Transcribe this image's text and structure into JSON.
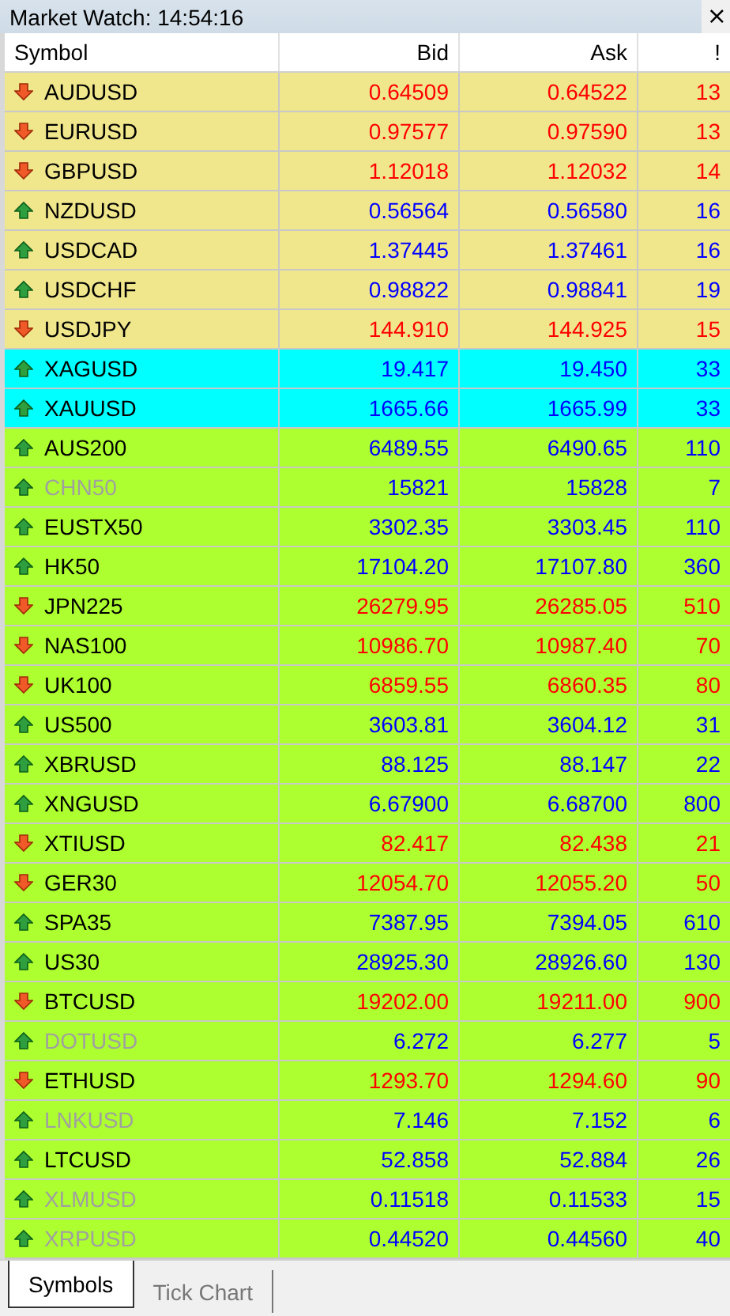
{
  "window": {
    "title": "Market Watch: 14:54:16",
    "close": "×"
  },
  "table": {
    "columns": [
      "Symbol",
      "Bid",
      "Ask",
      "!"
    ],
    "rows": [
      {
        "symbol": "AUDUSD",
        "rising": false,
        "disabled": false,
        "bid": "0.64509",
        "ask": "0.64522",
        "spread": "13",
        "color": "#f0e68c"
      },
      {
        "symbol": "EURUSD",
        "rising": false,
        "disabled": false,
        "bid": "0.97577",
        "ask": "0.97590",
        "spread": "13",
        "color": "#f0e68c"
      },
      {
        "symbol": "GBPUSD",
        "rising": false,
        "disabled": false,
        "bid": "1.12018",
        "ask": "1.12032",
        "spread": "14",
        "color": "#f0e68c"
      },
      {
        "symbol": "NZDUSD",
        "rising": true,
        "disabled": false,
        "bid": "0.56564",
        "ask": "0.56580",
        "spread": "16",
        "color": "#f0e68c"
      },
      {
        "symbol": "USDCAD",
        "rising": true,
        "disabled": false,
        "bid": "1.37445",
        "ask": "1.37461",
        "spread": "16",
        "color": "#f0e68c"
      },
      {
        "symbol": "USDCHF",
        "rising": true,
        "disabled": false,
        "bid": "0.98822",
        "ask": "0.98841",
        "spread": "19",
        "color": "#f0e68c"
      },
      {
        "symbol": "USDJPY",
        "rising": false,
        "disabled": false,
        "bid": "144.910",
        "ask": "144.925",
        "spread": "15",
        "color": "#f0e68c"
      },
      {
        "symbol": "XAGUSD",
        "rising": true,
        "disabled": false,
        "bid": "19.417",
        "ask": "19.450",
        "spread": "33",
        "color": "#00ffff"
      },
      {
        "symbol": "XAUUSD",
        "rising": true,
        "disabled": false,
        "bid": "1665.66",
        "ask": "1665.99",
        "spread": "33",
        "color": "#00ffff"
      },
      {
        "symbol": "AUS200",
        "rising": true,
        "disabled": false,
        "bid": "6489.55",
        "ask": "6490.65",
        "spread": "110",
        "color": "#adff2f"
      },
      {
        "symbol": "CHN50",
        "rising": true,
        "disabled": true,
        "bid": "15821",
        "ask": "15828",
        "spread": "7",
        "color": "#adff2f"
      },
      {
        "symbol": "EUSTX50",
        "rising": true,
        "disabled": false,
        "bid": "3302.35",
        "ask": "3303.45",
        "spread": "110",
        "color": "#adff2f"
      },
      {
        "symbol": "HK50",
        "rising": true,
        "disabled": false,
        "bid": "17104.20",
        "ask": "17107.80",
        "spread": "360",
        "color": "#adff2f"
      },
      {
        "symbol": "JPN225",
        "rising": false,
        "disabled": false,
        "bid": "26279.95",
        "ask": "26285.05",
        "spread": "510",
        "color": "#adff2f"
      },
      {
        "symbol": "NAS100",
        "rising": false,
        "disabled": false,
        "bid": "10986.70",
        "ask": "10987.40",
        "spread": "70",
        "color": "#adff2f"
      },
      {
        "symbol": "UK100",
        "rising": false,
        "disabled": false,
        "bid": "6859.55",
        "ask": "6860.35",
        "spread": "80",
        "color": "#adff2f"
      },
      {
        "symbol": "US500",
        "rising": true,
        "disabled": false,
        "bid": "3603.81",
        "ask": "3604.12",
        "spread": "31",
        "color": "#adff2f"
      },
      {
        "symbol": "XBRUSD",
        "rising": true,
        "disabled": false,
        "bid": "88.125",
        "ask": "88.147",
        "spread": "22",
        "color": "#adff2f"
      },
      {
        "symbol": "XNGUSD",
        "rising": true,
        "disabled": false,
        "bid": "6.67900",
        "ask": "6.68700",
        "spread": "800",
        "color": "#adff2f"
      },
      {
        "symbol": "XTIUSD",
        "rising": false,
        "disabled": false,
        "bid": "82.417",
        "ask": "82.438",
        "spread": "21",
        "color": "#adff2f"
      },
      {
        "symbol": "GER30",
        "rising": false,
        "disabled": false,
        "bid": "12054.70",
        "ask": "12055.20",
        "spread": "50",
        "color": "#adff2f"
      },
      {
        "symbol": "SPA35",
        "rising": true,
        "disabled": false,
        "bid": "7387.95",
        "ask": "7394.05",
        "spread": "610",
        "color": "#adff2f"
      },
      {
        "symbol": "US30",
        "rising": true,
        "disabled": false,
        "bid": "28925.30",
        "ask": "28926.60",
        "spread": "130",
        "color": "#adff2f"
      },
      {
        "symbol": "BTCUSD",
        "rising": false,
        "disabled": false,
        "bid": "19202.00",
        "ask": "19211.00",
        "spread": "900",
        "color": "#adff2f"
      },
      {
        "symbol": "DOTUSD",
        "rising": true,
        "disabled": true,
        "bid": "6.272",
        "ask": "6.277",
        "spread": "5",
        "color": "#adff2f"
      },
      {
        "symbol": "ETHUSD",
        "rising": false,
        "disabled": false,
        "bid": "1293.70",
        "ask": "1294.60",
        "spread": "90",
        "color": "#adff2f"
      },
      {
        "symbol": "LNKUSD",
        "rising": true,
        "disabled": true,
        "bid": "7.146",
        "ask": "7.152",
        "spread": "6",
        "color": "#adff2f"
      },
      {
        "symbol": "LTCUSD",
        "rising": true,
        "disabled": false,
        "bid": "52.858",
        "ask": "52.884",
        "spread": "26",
        "color": "#adff2f"
      },
      {
        "symbol": "XLMUSD",
        "rising": true,
        "disabled": true,
        "bid": "0.11518",
        "ask": "0.11533",
        "spread": "15",
        "color": "#adff2f"
      },
      {
        "symbol": "XRPUSD",
        "rising": true,
        "disabled": true,
        "bid": "0.44520",
        "ask": "0.44560",
        "spread": "40",
        "color": "#adff2f"
      }
    ]
  },
  "tabs": [
    {
      "label": "Symbols",
      "selected": true
    },
    {
      "label": "Tick Chart",
      "selected": false
    }
  ]
}
